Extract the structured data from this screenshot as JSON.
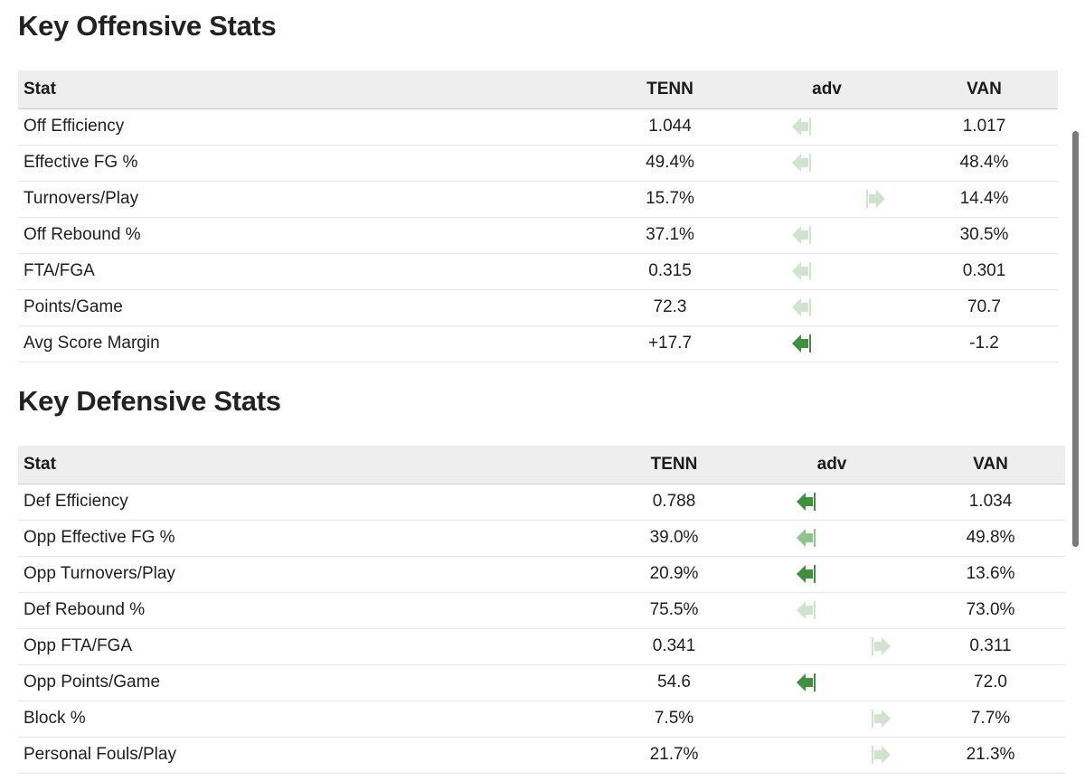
{
  "offensive": {
    "title": "Key Offensive Stats",
    "columns": [
      "Stat",
      "TENN",
      "adv",
      "VAN"
    ],
    "rows": [
      {
        "stat": "Off Efficiency",
        "tenn": "1.044",
        "van": "1.017",
        "adv_dir": "left",
        "adv_strength": "light"
      },
      {
        "stat": "Effective FG %",
        "tenn": "49.4%",
        "van": "48.4%",
        "adv_dir": "left",
        "adv_strength": "light"
      },
      {
        "stat": "Turnovers/Play",
        "tenn": "15.7%",
        "van": "14.4%",
        "adv_dir": "right",
        "adv_strength": "light"
      },
      {
        "stat": "Off Rebound %",
        "tenn": "37.1%",
        "van": "30.5%",
        "adv_dir": "left",
        "adv_strength": "light"
      },
      {
        "stat": "FTA/FGA",
        "tenn": "0.315",
        "van": "0.301",
        "adv_dir": "left",
        "adv_strength": "light"
      },
      {
        "stat": "Points/Game",
        "tenn": "72.3",
        "van": "70.7",
        "adv_dir": "left",
        "adv_strength": "light"
      },
      {
        "stat": "Avg Score Margin",
        "tenn": "+17.7",
        "van": "-1.2",
        "adv_dir": "left",
        "adv_strength": "strong"
      }
    ]
  },
  "defensive": {
    "title": "Key Defensive Stats",
    "columns": [
      "Stat",
      "TENN",
      "adv",
      "VAN"
    ],
    "rows": [
      {
        "stat": "Def Efficiency",
        "tenn": "0.788",
        "van": "1.034",
        "adv_dir": "left",
        "adv_strength": "strong"
      },
      {
        "stat": "Opp Effective FG %",
        "tenn": "39.0%",
        "van": "49.8%",
        "adv_dir": "left",
        "adv_strength": "medium"
      },
      {
        "stat": "Opp Turnovers/Play",
        "tenn": "20.9%",
        "van": "13.6%",
        "adv_dir": "left",
        "adv_strength": "strong"
      },
      {
        "stat": "Def Rebound %",
        "tenn": "75.5%",
        "van": "73.0%",
        "adv_dir": "left",
        "adv_strength": "light"
      },
      {
        "stat": "Opp FTA/FGA",
        "tenn": "0.341",
        "van": "0.311",
        "adv_dir": "right",
        "adv_strength": "light"
      },
      {
        "stat": "Opp Points/Game",
        "tenn": "54.6",
        "van": "72.0",
        "adv_dir": "left",
        "adv_strength": "strong"
      },
      {
        "stat": "Block %",
        "tenn": "7.5%",
        "van": "7.7%",
        "adv_dir": "right",
        "adv_strength": "light"
      },
      {
        "stat": "Personal Fouls/Play",
        "tenn": "21.7%",
        "van": "21.3%",
        "adv_dir": "right",
        "adv_strength": "light"
      }
    ]
  },
  "colors": {
    "arrow_strong": "#3f8f3f",
    "arrow_medium": "#8cc48c",
    "arrow_light": "#cfe3cf",
    "header_bg": "#eeeeee",
    "row_border": "#e6e6e6",
    "text": "#202020",
    "scrollbar_thumb": "#7a7a7a"
  }
}
